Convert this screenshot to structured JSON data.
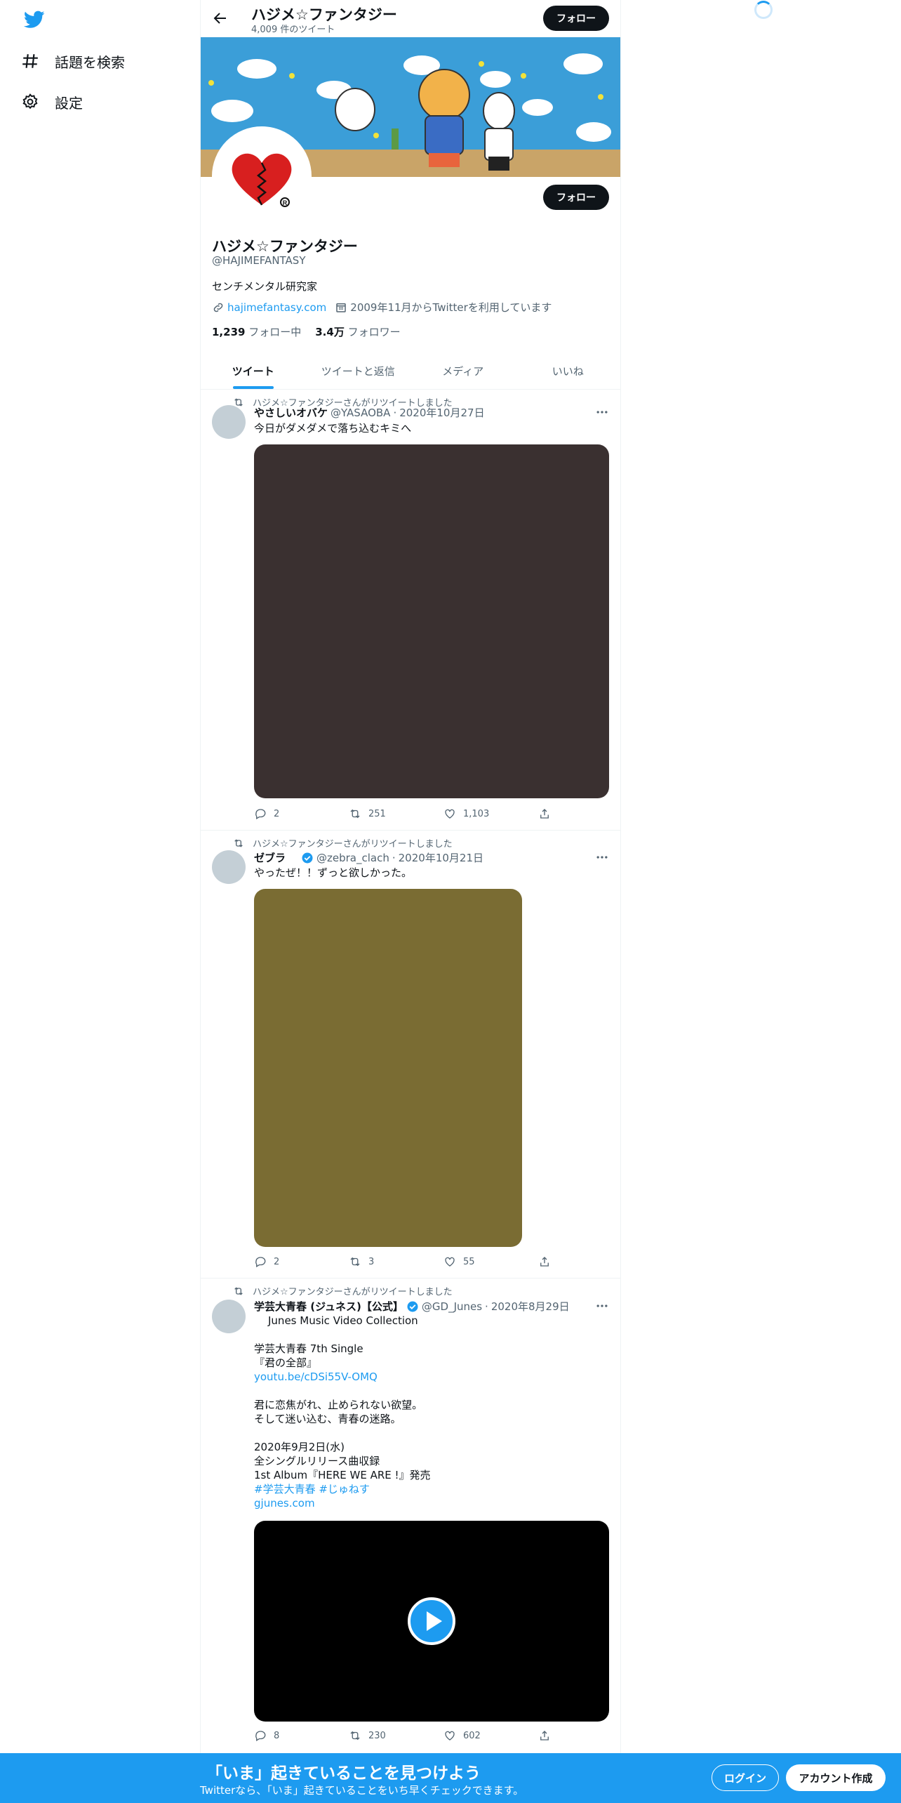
{
  "nav": {
    "items": [
      {
        "label": "話題を検索",
        "icon": "hashtag-icon"
      },
      {
        "label": "設定",
        "icon": "gear-icon"
      }
    ]
  },
  "header": {
    "title": "ハジメ☆ファンタジー",
    "subtitle": "4,009 件のツイート",
    "follow_label": "フォロー"
  },
  "profile": {
    "name": "ハジメ☆ファンタジー",
    "handle": "@HAJIMEFANTASY",
    "bio": "センチメンタル研究家",
    "website": "hajimefantasy.com",
    "joined": "2009年11月からTwitterを利用しています",
    "following_count": "1,239",
    "following_label": "フォロー中",
    "followers_count": "3.4万",
    "followers_label": "フォロワー",
    "follow_label": "フォロー"
  },
  "tabs": [
    {
      "label": "ツイート",
      "active": true
    },
    {
      "label": "ツイートと返信",
      "active": false
    },
    {
      "label": "メディア",
      "active": false
    },
    {
      "label": "いいね",
      "active": false
    }
  ],
  "tweets": [
    {
      "retweet_by": "ハジメ☆ファンタジーさんがリツイートしました",
      "name": "やさしいオバケ",
      "handle": "@YASAOBA",
      "date": "2020年10月27日",
      "verified": false,
      "text": "今日がダメダメで落ち込むキミへ",
      "media_color": "#3a3030",
      "replies": "2",
      "retweets": "251",
      "likes": "1,103"
    },
    {
      "retweet_by": "ハジメ☆ファンタジーさんがリツイートしました",
      "name": "ゼブラ",
      "handle": "@zebra_clach",
      "date": "2020年10月21日",
      "verified": true,
      "text": "やったぜ！！ずっと欲しかった。",
      "media_color": "#7a6c33",
      "replies": "2",
      "retweets": "3",
      "likes": "55"
    },
    {
      "retweet_by": "ハジメ☆ファンタジーさんがリツイートしました",
      "name": "学芸大青春 (ジュネス)【公式】",
      "handle": "@GD_Junes",
      "date": "2020年8月29日",
      "verified": true,
      "collection": "Junes Music Video Collection",
      "lines": [
        {
          "text": "学芸大青春 7th Single",
          "link": false
        },
        {
          "text": "『君の全部』",
          "link": false
        },
        {
          "text": "youtu.be/cDSi55V-OMQ",
          "link": true
        },
        {
          "text": "",
          "link": false
        },
        {
          "text": "君に恋焦がれ、止められない欲望。",
          "link": false
        },
        {
          "text": "そして迷い込む、青春の迷路。",
          "link": false
        },
        {
          "text": "",
          "link": false
        },
        {
          "text": "2020年9月2日(水)",
          "link": false
        },
        {
          "text": "全シングルリリース曲収録",
          "link": false
        },
        {
          "text": "1st Album『HERE WE ARE !』発売",
          "link": false
        },
        {
          "text": "#学芸大青春 #じゅねす",
          "link": true
        },
        {
          "text": "gjunes.com",
          "link": true
        }
      ],
      "media_color": "#000000",
      "replies": "8",
      "retweets": "230",
      "likes": "602"
    }
  ],
  "bottom_bar": {
    "title": "「いま」起きていることを見つけよう",
    "subtitle": "Twitterなら、「いま」起きていることをいち早くチェックできます。",
    "login_label": "ログイン",
    "signup_label": "アカウント作成"
  },
  "colors": {
    "accent": "#1d9bf0",
    "text": "#0f1419",
    "muted": "#536471"
  }
}
